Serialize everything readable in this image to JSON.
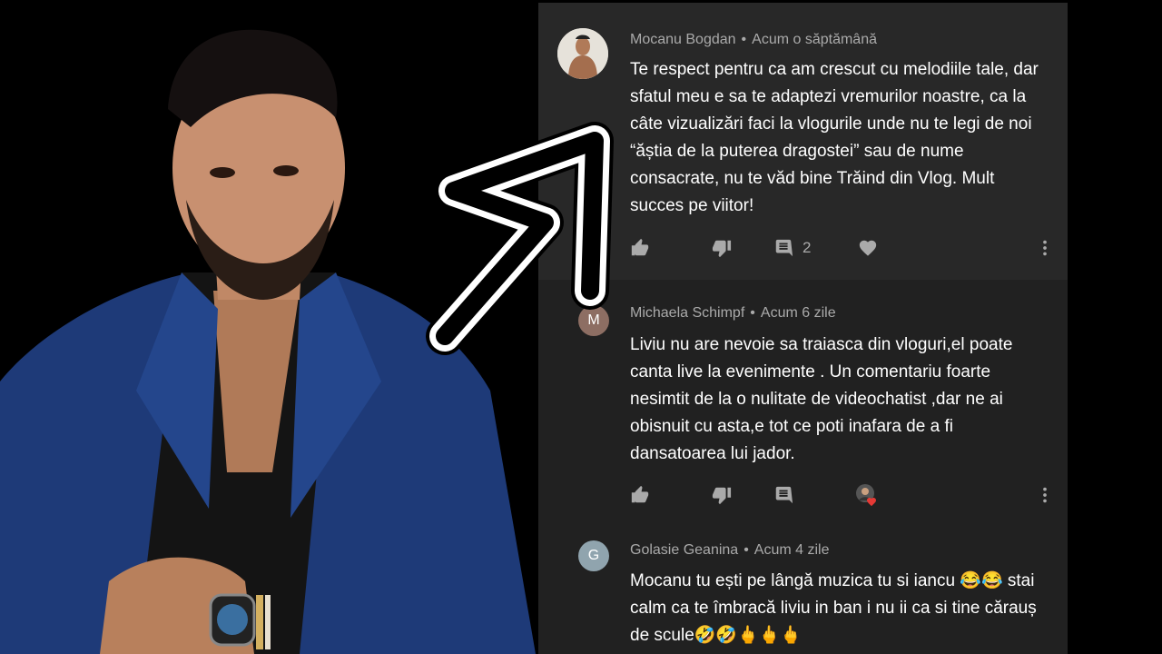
{
  "comments": [
    {
      "author": "Mocanu Bogdan",
      "separator": "•",
      "time": "Acum o săptămână",
      "text": "Te respect pentru ca am crescut cu melodiile tale, dar sfatul meu e sa te adaptezi vremurilor noastre, ca la câte vizualizări faci la vlogurile unde nu te legi de noi “ăștia de la puterea dragostei” sau de nume consacrate, nu te văd bine Trăind din Vlog. Mult succes pe viitor!",
      "reply_count": "2",
      "avatar_type": "photo"
    },
    {
      "author": "Michaela Schimpf",
      "separator": "•",
      "time": "Acum 6 zile",
      "text": "Liviu nu are nevoie sa traiasca din vloguri,el poate canta live la evenimente . Un comentariu foarte nesimtit de la o nulitate de videochatist ,dar ne ai obisnuit cu asta,e tot ce poti inafara de a fi dansatoarea lui jador.",
      "avatar_letter": "M",
      "avatar_color": "#8d6e63"
    },
    {
      "author": "Golasie Geanina",
      "separator": "•",
      "time": "Acum 4 zile",
      "text": "Mocanu tu ești pe lângă muzica tu si iancu 😂😂 stai calm ca te îmbracă liviu in ban i nu ii ca si tine cărauș de scule🤣🤣🖕🖕🖕",
      "avatar_letter": "G",
      "avatar_color": "#90a4ae"
    }
  ],
  "icons": {
    "like": "thumb-up-icon",
    "dislike": "thumb-down-icon",
    "reply": "reply-icon",
    "heart": "heart-icon",
    "more": "more-vert-icon"
  },
  "colors": {
    "panel_bg": "#212121",
    "highlight_bg": "#282828",
    "meta_text": "#aaaaaa",
    "body_text": "#ffffff"
  }
}
